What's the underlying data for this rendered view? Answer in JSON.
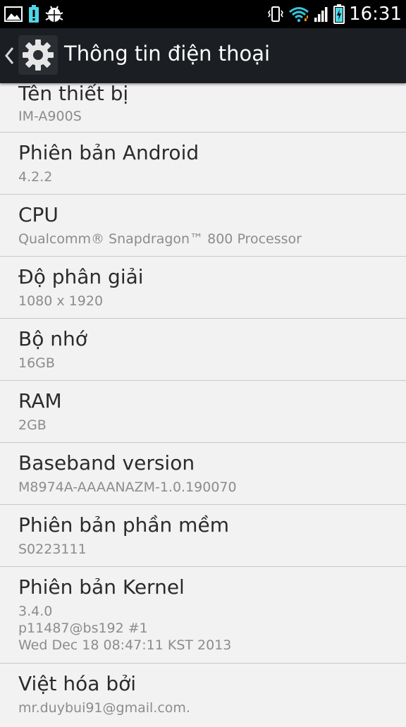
{
  "status_bar": {
    "time": "16:31",
    "icons_left": [
      "gallery-icon",
      "alert-battery-icon",
      "android-debug-icon"
    ],
    "icons_right": [
      "vibrate-icon",
      "wifi-icon",
      "signal-icon",
      "battery-charging-icon"
    ]
  },
  "action_bar": {
    "title": "Thông tin  điện thoại",
    "icon": "settings-gear-icon"
  },
  "items": [
    {
      "label": "Tên thiết bị",
      "value": "IM-A900S"
    },
    {
      "label": "Phiên bản Android",
      "value": "4.2.2"
    },
    {
      "label": "CPU",
      "value": "Qualcomm® Snapdragon™ 800 Processor"
    },
    {
      "label": "Độ phân giải",
      "value": "1080 x 1920"
    },
    {
      "label": "Bộ nhớ",
      "value": "16GB"
    },
    {
      "label": "RAM",
      "value": "2GB"
    },
    {
      "label": "Baseband version",
      "value": "M8974A-AAAANAZM-1.0.190070"
    },
    {
      "label": "Phiên bản phần mềm",
      "value": "S0223111"
    },
    {
      "label": "Phiên bản Kernel",
      "value_lines": [
        "3.4.0",
        "p11487@bs192 #1",
        "Wed Dec 18 08:47:11 KST 2013"
      ]
    },
    {
      "label": "Việt hóa bởi",
      "value": "mr.duybui91@gmail.com."
    }
  ],
  "colors": {
    "status_bar_bg": "#000000",
    "action_bar_bg": "#1b1e22",
    "list_bg": "#f2f2f2",
    "label_text": "#2b2b2b",
    "value_text": "#8c8c8c",
    "divider": "#c8c8c8",
    "wifi_accent": "#35c3d9",
    "battery_accent": "#4fd6e6"
  }
}
